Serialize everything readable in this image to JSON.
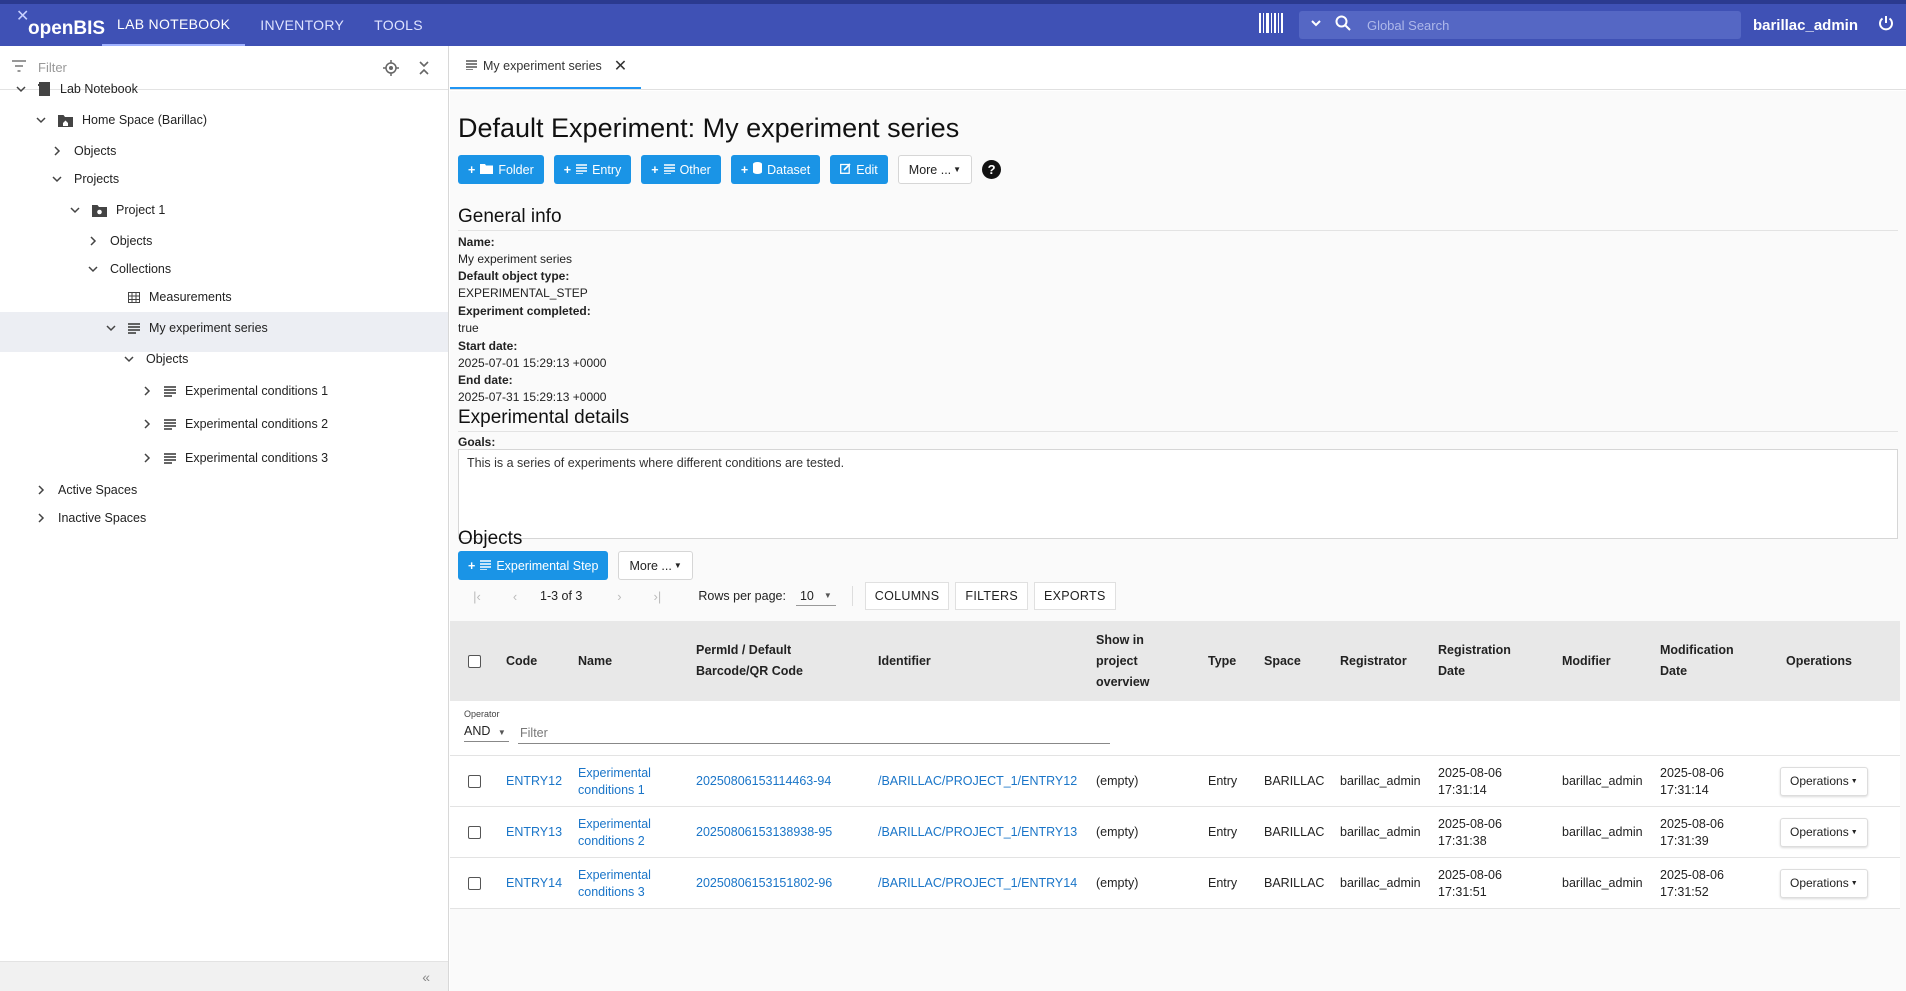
{
  "app": {
    "logo_text": "openBIS",
    "nav_tabs": [
      {
        "label": "LAB NOTEBOOK"
      },
      {
        "label": "INVENTORY"
      },
      {
        "label": "TOOLS"
      }
    ],
    "search_placeholder": "Global Search",
    "username": "barillac_admin",
    "accent_color": "#3f51b5",
    "button_color": "#1a94e6"
  },
  "sidebar": {
    "filter_placeholder": "Filter",
    "tree": [
      {
        "label": "Lab Notebook",
        "icon": "notebook-icon"
      },
      {
        "label": "Home Space (Barillac)",
        "icon": "home-folder-icon"
      },
      {
        "label": "Objects",
        "icon": ""
      },
      {
        "label": "Projects",
        "icon": ""
      },
      {
        "label": "Project 1",
        "icon": "project-folder-icon"
      },
      {
        "label": "Objects",
        "icon": ""
      },
      {
        "label": "Collections",
        "icon": ""
      },
      {
        "label": "Measurements",
        "icon": "table-icon"
      },
      {
        "label": "My experiment series",
        "icon": "list-icon"
      },
      {
        "label": "Objects",
        "icon": ""
      },
      {
        "label": "Experimental conditions 1",
        "icon": "list-icon"
      },
      {
        "label": "Experimental conditions 2",
        "icon": "list-icon"
      },
      {
        "label": "Experimental conditions 3",
        "icon": "list-icon"
      },
      {
        "label": "Active Spaces",
        "icon": ""
      },
      {
        "label": "Inactive Spaces",
        "icon": ""
      }
    ]
  },
  "main": {
    "tab_label": "My experiment series",
    "title": "Default Experiment: My experiment series",
    "buttons": {
      "folder": "Folder",
      "entry": "Entry",
      "other": "Other",
      "dataset": "Dataset",
      "edit": "Edit",
      "more": "More ...",
      "help": "?"
    },
    "general_info": {
      "heading": "General info",
      "fields": [
        {
          "label": "Name:",
          "value": "My experiment series"
        },
        {
          "label": "Default object type:",
          "value": "EXPERIMENTAL_STEP"
        },
        {
          "label": "Experiment completed:",
          "value": "true"
        },
        {
          "label": "Start date:",
          "value": "2025-07-01 15:29:13 +0000"
        },
        {
          "label": "End date:",
          "value": "2025-07-31 15:29:13 +0000"
        }
      ]
    },
    "experimental_details": {
      "heading": "Experimental details",
      "goals_label": "Goals:",
      "goals_text": "This is a series of experiments where different conditions are tested."
    },
    "objects": {
      "heading": "Objects",
      "add_button": "Experimental Step",
      "more_button": "More ...",
      "pager_text": "1-3 of 3",
      "rows_per_page_label": "Rows per page:",
      "rows_per_page_value": "10",
      "columns_button": "COLUMNS",
      "filters_button": "FILTERS",
      "exports_button": "EXPORTS",
      "operator_label": "Operator",
      "operator_value": "AND",
      "filter_placeholder": "Filter",
      "headers": {
        "code": "Code",
        "name": "Name",
        "permid": "PermId / Default Barcode/QR Code",
        "identifier": "Identifier",
        "show": "Show in project overview",
        "type": "Type",
        "space": "Space",
        "registrator": "Registrator",
        "reg_date": "Registration Date",
        "modifier": "Modifier",
        "mod_date": "Modification Date",
        "operations": "Operations"
      },
      "rows": [
        {
          "code": "ENTRY12",
          "name": "Experimental conditions 1",
          "permid": "20250806153114463-94",
          "identifier": "/BARILLAC/PROJECT_1/ENTRY12",
          "show": "(empty)",
          "type": "Entry",
          "space": "BARILLAC",
          "registrator": "barillac_admin",
          "reg_date": "2025-08-06 17:31:14",
          "modifier": "barillac_admin",
          "mod_date": "2025-08-06 17:31:14",
          "operations": "Operations"
        },
        {
          "code": "ENTRY13",
          "name": "Experimental conditions 2",
          "permid": "20250806153138938-95",
          "identifier": "/BARILLAC/PROJECT_1/ENTRY13",
          "show": "(empty)",
          "type": "Entry",
          "space": "BARILLAC",
          "registrator": "barillac_admin",
          "reg_date": "2025-08-06 17:31:38",
          "modifier": "barillac_admin",
          "mod_date": "2025-08-06 17:31:39",
          "operations": "Operations"
        },
        {
          "code": "ENTRY14",
          "name": "Experimental conditions 3",
          "permid": "20250806153151802-96",
          "identifier": "/BARILLAC/PROJECT_1/ENTRY14",
          "show": "(empty)",
          "type": "Entry",
          "space": "BARILLAC",
          "registrator": "barillac_admin",
          "reg_date": "2025-08-06 17:31:51",
          "modifier": "barillac_admin",
          "mod_date": "2025-08-06 17:31:52",
          "operations": "Operations"
        }
      ]
    }
  }
}
